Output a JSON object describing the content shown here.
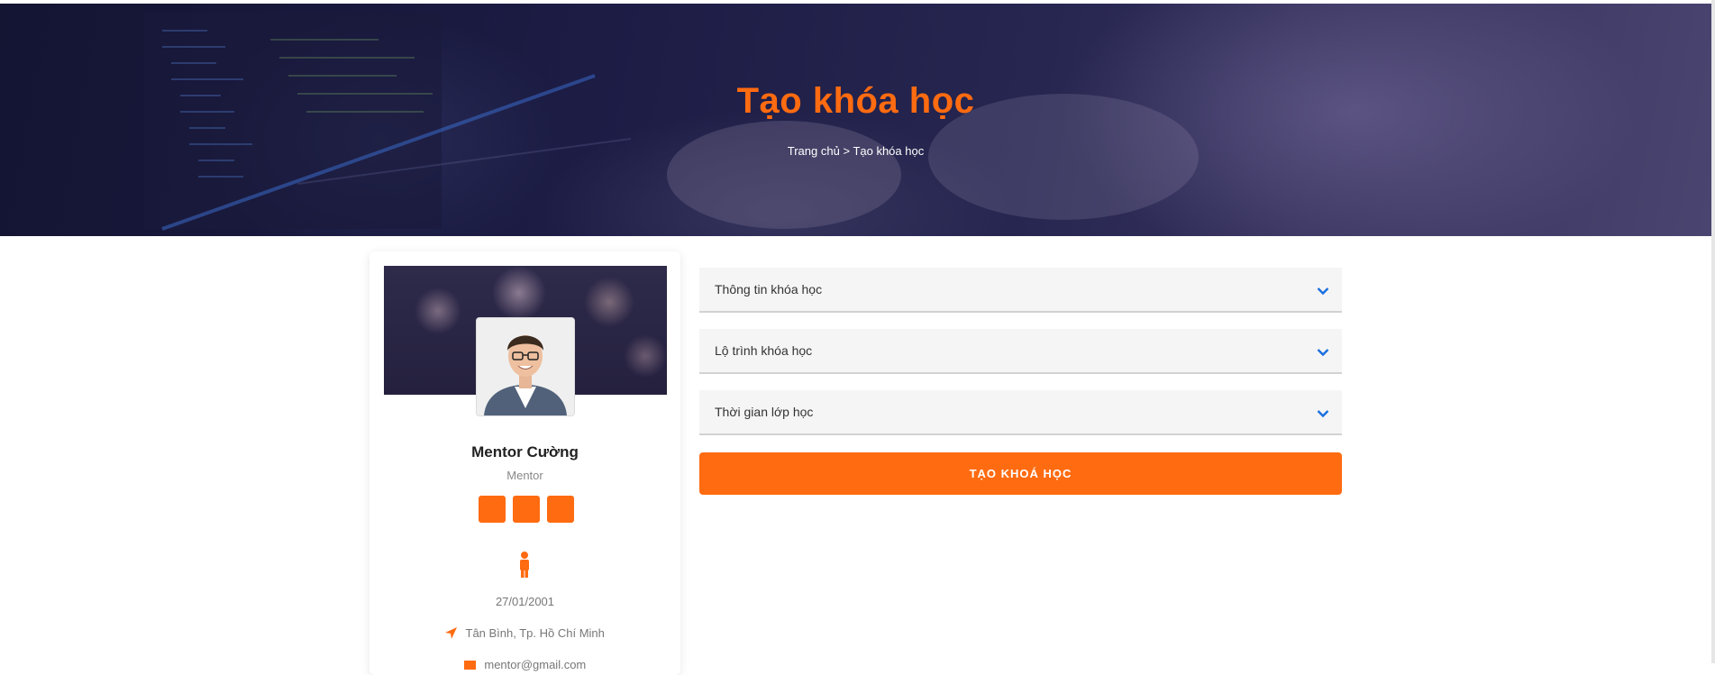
{
  "hero": {
    "title": "Tạo khóa học",
    "breadcrumb": {
      "home": "Trang chủ",
      "separator": ">",
      "current": "Tạo khóa học"
    }
  },
  "profile": {
    "name": "Mentor Cường",
    "role": "Mentor",
    "birthdate": "27/01/2001",
    "address": "Tân Bình, Tp. Hồ Chí Minh",
    "email": "mentor@gmail.com",
    "social_buttons": [
      "social-icon",
      "social-icon",
      "social-icon"
    ]
  },
  "form": {
    "sections": [
      {
        "label": "Thông tin khóa học",
        "icon": "chevron-down-icon"
      },
      {
        "label": "Lộ trình khóa học",
        "icon": "chevron-down-icon"
      },
      {
        "label": "Thời gian lớp học",
        "icon": "chevron-down-icon"
      }
    ],
    "submit_label": "TẠO KHOÁ HỌC"
  },
  "colors": {
    "accent": "#ff6b11",
    "chevron": "#1a6fe0",
    "hero_bg": "#1c1c45",
    "accordion_bg": "#f5f5f5"
  }
}
